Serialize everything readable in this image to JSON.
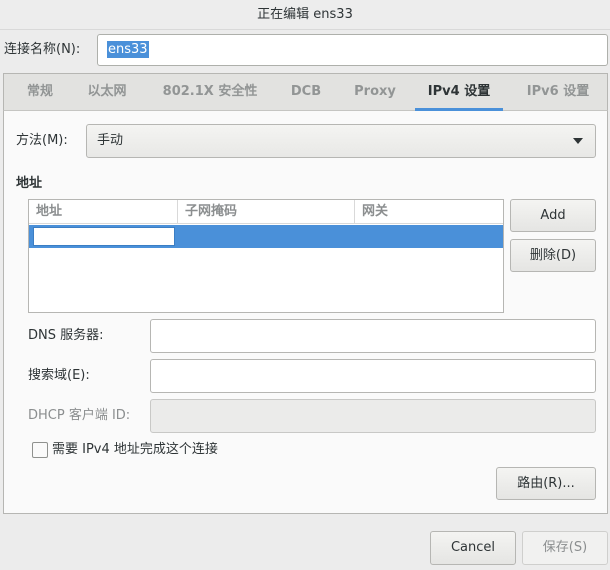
{
  "window": {
    "title": "正在编辑 ens33"
  },
  "connection": {
    "name_label": "连接名称(N):",
    "name_value": "ens33"
  },
  "tabs": [
    {
      "label": "常规",
      "active": false
    },
    {
      "label": "以太网",
      "active": false
    },
    {
      "label": "802.1X 安全性",
      "active": false
    },
    {
      "label": "DCB",
      "active": false
    },
    {
      "label": "Proxy",
      "active": false
    },
    {
      "label": "IPv4 设置",
      "active": true
    },
    {
      "label": "IPv6 设置",
      "active": false
    }
  ],
  "ipv4": {
    "method_label": "方法(M):",
    "method_value": "手动",
    "address_heading": "地址",
    "address_columns": [
      "地址",
      "子网掩码",
      "网关"
    ],
    "address_rows": [
      {
        "address": "",
        "netmask": "",
        "gateway": ""
      }
    ],
    "add_label": "Add",
    "delete_label": "删除(D)",
    "dns_label": "DNS 服务器:",
    "dns_value": "",
    "search_label": "搜索域(E):",
    "search_value": "",
    "dhcp_label": "DHCP 客户端 ID:",
    "dhcp_value": "",
    "require_label": "需要 IPv4 地址完成这个连接",
    "require_checked": false,
    "routes_label": "路由(R)..."
  },
  "footer": {
    "cancel_label": "Cancel",
    "save_label": "保存(S)"
  },
  "colors": {
    "accent": "#4a90d9"
  }
}
